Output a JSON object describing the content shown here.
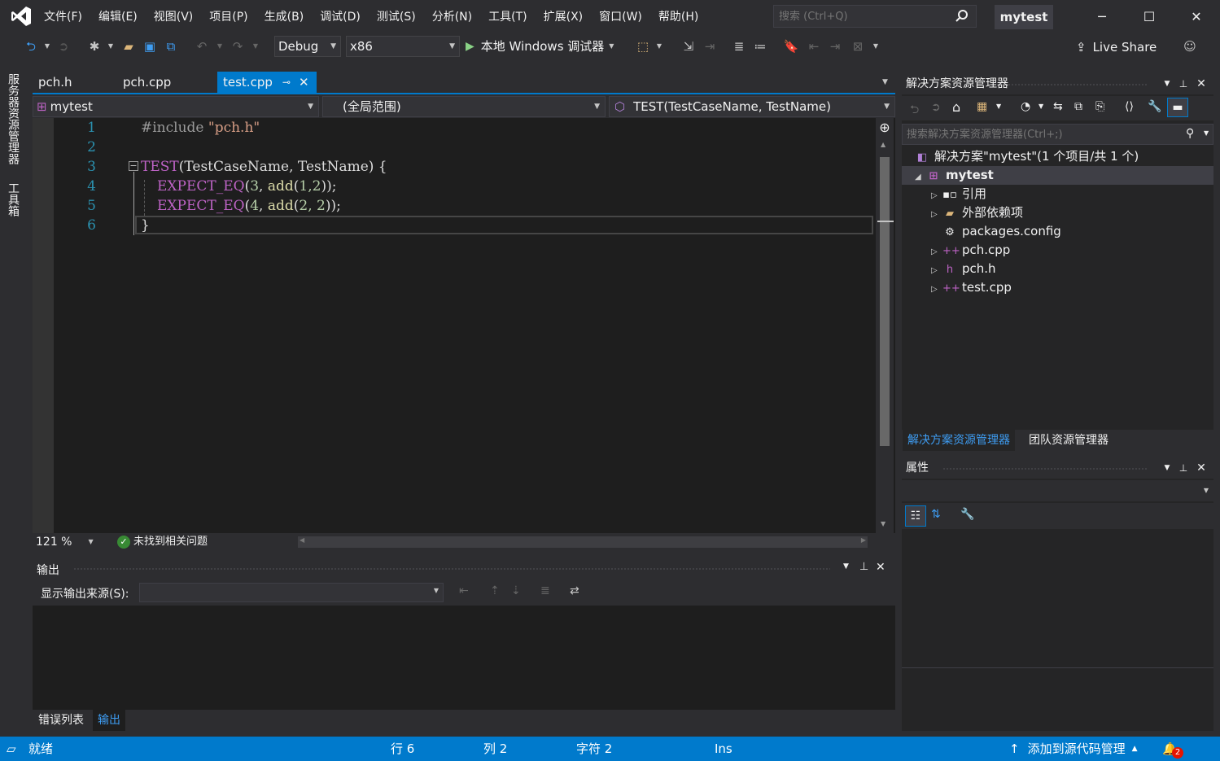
{
  "menu": [
    "文件(F)",
    "编辑(E)",
    "视图(V)",
    "项目(P)",
    "生成(B)",
    "调试(D)",
    "测试(S)",
    "分析(N)",
    "工具(T)",
    "扩展(X)",
    "窗口(W)",
    "帮助(H)"
  ],
  "search": {
    "placeholder": "搜索 (Ctrl+Q)"
  },
  "project_title": "mytest",
  "toolbar": {
    "config": "Debug",
    "platform": "x86",
    "run_label": "本地 Windows 调试器",
    "live_share": "Live Share"
  },
  "side_tabs": [
    "服务器资源管理器",
    "工具箱"
  ],
  "doc_tabs": [
    {
      "label": "pch.h"
    },
    {
      "label": "pch.cpp"
    },
    {
      "label": "test.cpp"
    }
  ],
  "navbar": {
    "project": "mytest",
    "scope": "(全局范围)",
    "member": "TEST(TestCaseName, TestName)"
  },
  "code": {
    "line_numbers": [
      "1",
      "2",
      "3",
      "4",
      "5",
      "6"
    ],
    "include_kw": "#include",
    "include_file": "\"pch.h\"",
    "test_macro": "TEST",
    "test_args": "(TestCaseName, TestName) {",
    "expect": "EXPECT_EQ",
    "l4_a": "3",
    "l4_b": "1,2",
    "l5_a": "4",
    "l5_b": "2, 2",
    "add": "add",
    "close_brace": "}"
  },
  "editor_status": {
    "zoom": "121 %",
    "issues": "未找到相关问题"
  },
  "output": {
    "title": "输出",
    "source_label": "显示输出来源(S):",
    "source_value": ""
  },
  "bottom_tabs": [
    "错误列表",
    "输出"
  ],
  "solution_explorer": {
    "title": "解决方案资源管理器",
    "search_placeholder": "搜索解决方案资源管理器(Ctrl+;)",
    "solution": "解决方案\"mytest\"(1 个项目/共 1 个)",
    "project": "mytest",
    "items": [
      "引用",
      "外部依赖项",
      "packages.config",
      "pch.cpp",
      "pch.h",
      "test.cpp"
    ]
  },
  "sol_tabs": [
    "解决方案资源管理器",
    "团队资源管理器"
  ],
  "properties": {
    "title": "属性"
  },
  "statusbar": {
    "ready": "就绪",
    "line": "行 6",
    "col": "列 2",
    "char": "字符 2",
    "ins": "Ins",
    "source_control": "添加到源代码管理",
    "notifications": "2"
  },
  "colors": {
    "accent": "#007acc",
    "background": "#2d2d30",
    "editor_bg": "#1e1e1e",
    "line_number": "#2b91af",
    "macro": "#bd63c5",
    "string": "#d69d85"
  }
}
